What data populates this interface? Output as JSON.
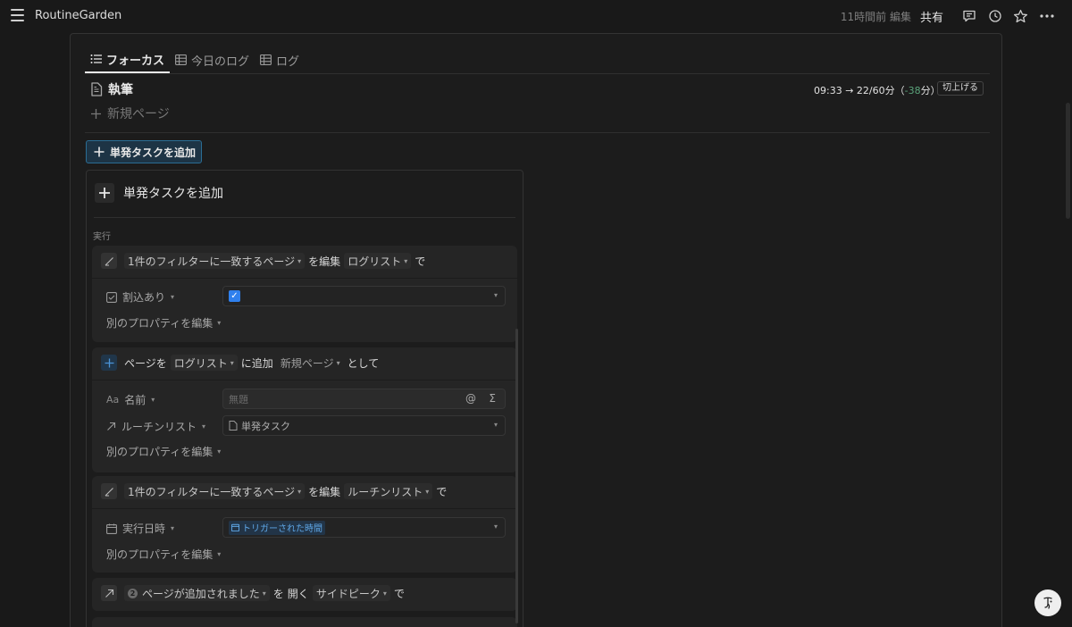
{
  "app": {
    "title": "RoutineGarden"
  },
  "topbar": {
    "edited": "11時間前 編集",
    "share": "共有",
    "icons": [
      "comment-icon",
      "history-icon",
      "star-icon",
      "more-icon"
    ]
  },
  "tabs": [
    {
      "label": "フォーカス",
      "icon": "list-icon",
      "active": true
    },
    {
      "label": "今日のログ",
      "icon": "table-icon",
      "active": false
    },
    {
      "label": "ログ",
      "icon": "table-icon",
      "active": false
    }
  ],
  "page": {
    "title": "執筆",
    "new_page": "新規ページ",
    "time_prefix": "09:33 → 22/60分（",
    "time_delta": "-38",
    "time_suffix": "分）",
    "roundup": "切上げる"
  },
  "add_button": "単発タスクを追加",
  "automation": {
    "title": "単発タスクを追加",
    "section_label": "実行",
    "card1": {
      "filter": "1件のフィルターに一致するページ",
      "verb": "を編集",
      "db": "ログリスト",
      "suffix": "で",
      "prop_name": "割込あり",
      "more": "別のプロパティを編集"
    },
    "card2": {
      "prefix": "ページを",
      "db": "ログリスト",
      "verb": "に追加",
      "template": "新規ページ",
      "suffix": "として",
      "prop1_name": "名前",
      "prop1_placeholder": "無題",
      "prop2_name": "ルーチンリスト",
      "prop2_value": "単発タスク",
      "more": "別のプロパティを編集"
    },
    "card3": {
      "filter": "1件のフィルターに一致するページ",
      "verb": "を編集",
      "db": "ルーチンリスト",
      "suffix": "で",
      "prop_name": "実行日時",
      "prop_value": "トリガーされた時間",
      "more": "別のプロパティを編集"
    },
    "card4": {
      "badge": "2",
      "source": "ページが追加されました",
      "particle": "を",
      "verb": "開く",
      "mode": "サイドピーク",
      "suffix": "で"
    }
  }
}
